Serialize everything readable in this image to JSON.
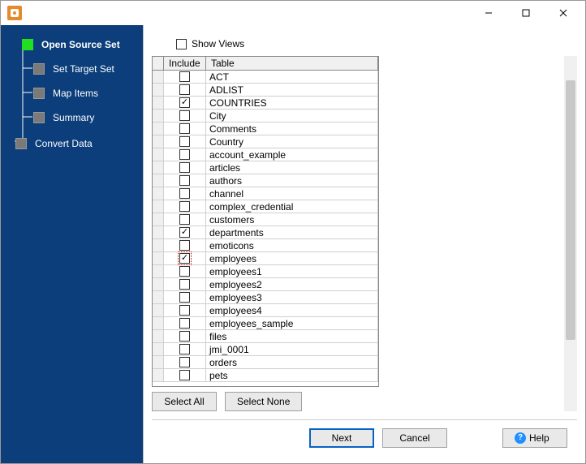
{
  "window": {
    "min": "—",
    "max": "▢",
    "close": "✕"
  },
  "sidebar": {
    "steps": [
      {
        "label": "Open Source Set",
        "active": true,
        "bold": true,
        "sub": false
      },
      {
        "label": "Set Target Set",
        "active": false,
        "bold": false,
        "sub": true
      },
      {
        "label": "Map Items",
        "active": false,
        "bold": false,
        "sub": true
      },
      {
        "label": "Summary",
        "active": false,
        "bold": false,
        "sub": true
      },
      {
        "label": "Convert Data",
        "active": false,
        "bold": false,
        "sub": false
      }
    ]
  },
  "main": {
    "show_views_label": "Show Views",
    "show_views_checked": false,
    "columns": {
      "include": "Include",
      "table": "Table"
    },
    "rows": [
      {
        "table": "ACT",
        "include": false
      },
      {
        "table": "ADLIST",
        "include": false
      },
      {
        "table": "COUNTRIES",
        "include": true
      },
      {
        "table": "City",
        "include": false
      },
      {
        "table": "Comments",
        "include": false
      },
      {
        "table": "Country",
        "include": false
      },
      {
        "table": "account_example",
        "include": false
      },
      {
        "table": "articles",
        "include": false
      },
      {
        "table": "authors",
        "include": false
      },
      {
        "table": "channel",
        "include": false
      },
      {
        "table": "complex_credential",
        "include": false
      },
      {
        "table": "customers",
        "include": false
      },
      {
        "table": "departments",
        "include": true
      },
      {
        "table": "emoticons",
        "include": false
      },
      {
        "table": "employees",
        "include": true,
        "focused": true
      },
      {
        "table": "employees1",
        "include": false
      },
      {
        "table": "employees2",
        "include": false
      },
      {
        "table": "employees3",
        "include": false
      },
      {
        "table": "employees4",
        "include": false
      },
      {
        "table": "employees_sample",
        "include": false
      },
      {
        "table": "files",
        "include": false
      },
      {
        "table": "jmi_0001",
        "include": false
      },
      {
        "table": "orders",
        "include": false
      },
      {
        "table": "pets",
        "include": false
      }
    ],
    "buttons": {
      "select_all": "Select All",
      "select_none": "Select None"
    }
  },
  "footer": {
    "next": "Next",
    "cancel": "Cancel",
    "help": "Help"
  }
}
